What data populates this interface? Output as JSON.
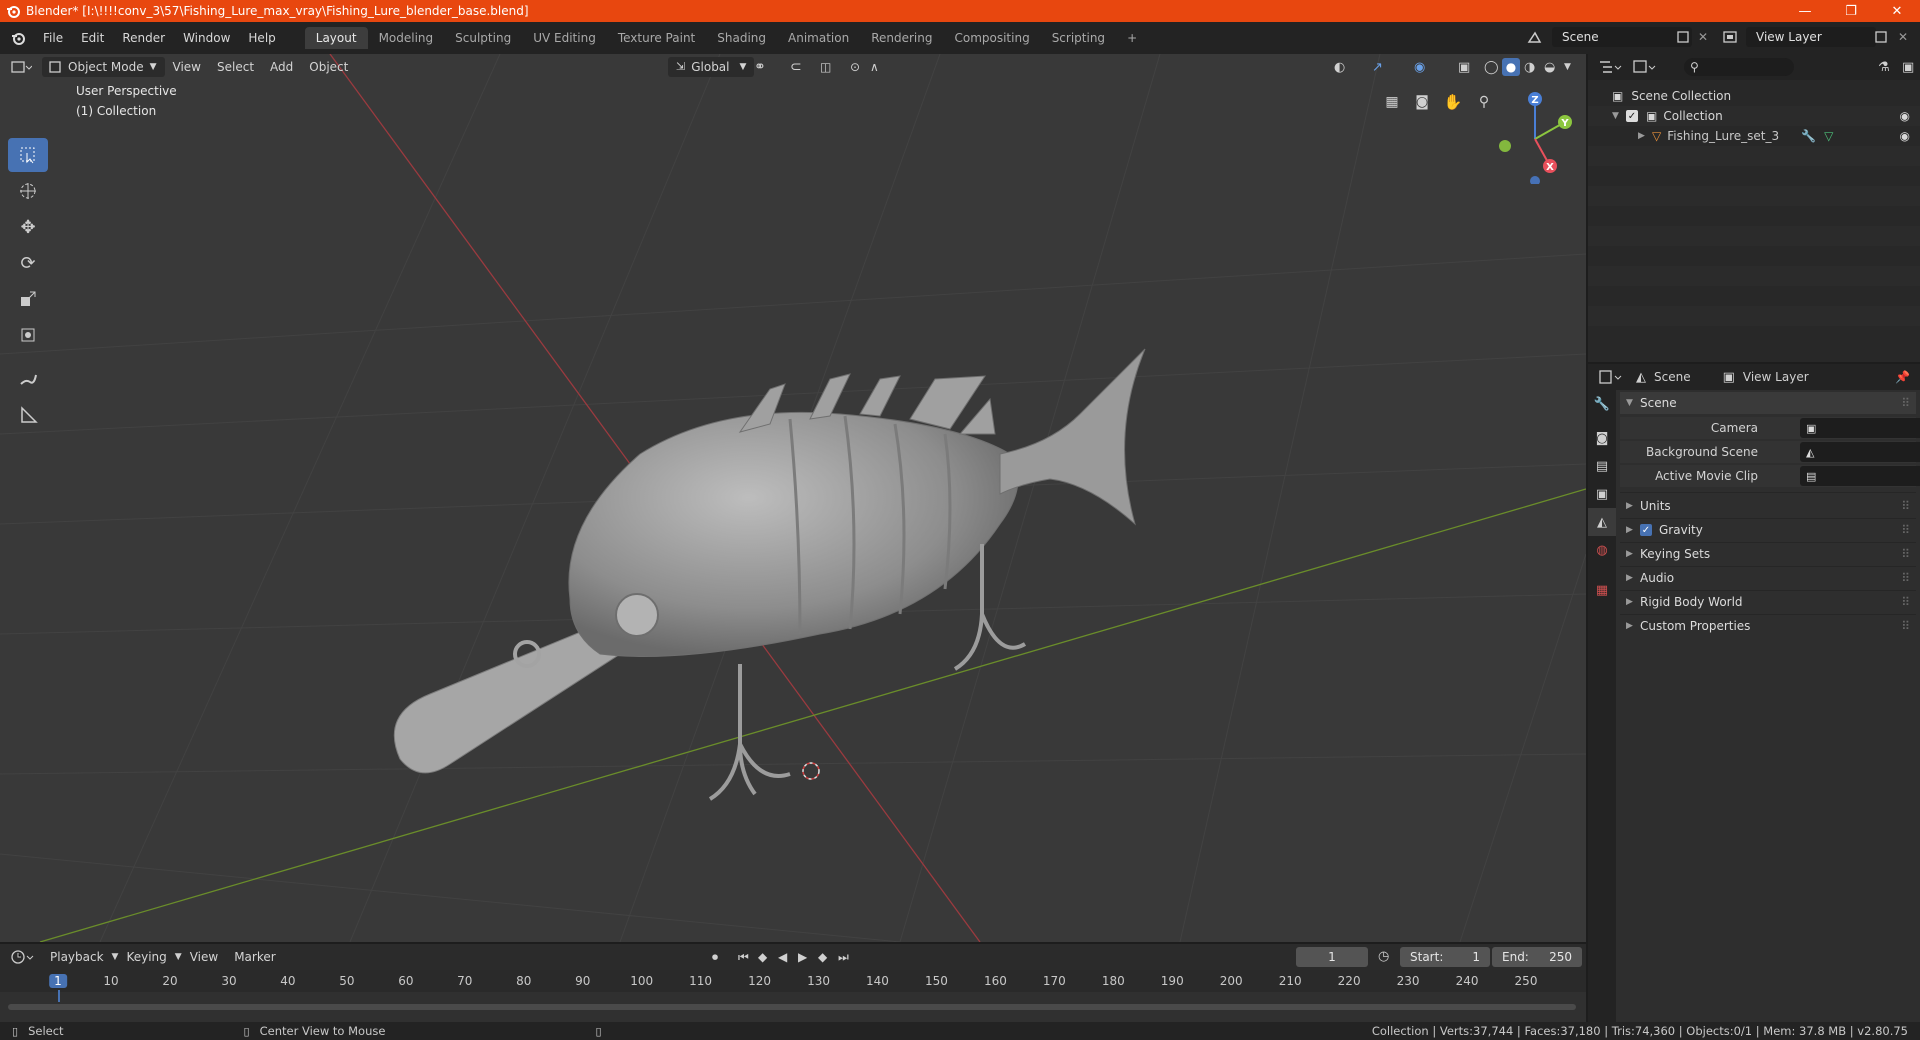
{
  "title_bar": {
    "title": "Blender* [I:\\!!!!conv_3\\57\\Fishing_Lure_max_vray\\Fishing_Lure_blender_base.blend]",
    "minimize": "—",
    "maximize": "❐",
    "close": "✕"
  },
  "menu": {
    "items": [
      "File",
      "Edit",
      "Render",
      "Window",
      "Help"
    ],
    "workspaces": [
      "Layout",
      "Modeling",
      "Sculpting",
      "UV Editing",
      "Texture Paint",
      "Shading",
      "Animation",
      "Rendering",
      "Compositing",
      "Scripting"
    ],
    "active_workspace": "Layout",
    "add_workspace": "+",
    "scene_name": "Scene",
    "view_layer": "View Layer"
  },
  "viewport": {
    "mode": "Object Mode",
    "menus": [
      "View",
      "Select",
      "Add",
      "Object"
    ],
    "transform_orientation": "Global",
    "perspective_label": "User Perspective",
    "collection_label": "(1) Collection",
    "gizmo_axes": {
      "z": "Z",
      "y": "Y",
      "x": "X"
    }
  },
  "outliner": {
    "scene_collection": "Scene Collection",
    "collection": "Collection",
    "object": "Fishing_Lure_set_3",
    "search_placeholder": ""
  },
  "properties": {
    "header_scene": "Scene",
    "header_view_layer": "View Layer",
    "panel_title": "Scene",
    "fields": {
      "camera": "Camera",
      "background_scene": "Background Scene",
      "active_movie_clip": "Active Movie Clip"
    },
    "subpanels": [
      "Units",
      "Gravity",
      "Keying Sets",
      "Audio",
      "Rigid Body World",
      "Custom Properties"
    ],
    "gravity_checked": true
  },
  "timeline": {
    "menus": [
      "Playback",
      "Keying",
      "View",
      "Marker"
    ],
    "current_frame": "1",
    "start_label": "Start:",
    "start": "1",
    "end_label": "End:",
    "end": "250",
    "ruler_marks": [
      "1",
      "10",
      "20",
      "30",
      "40",
      "50",
      "60",
      "70",
      "80",
      "90",
      "100",
      "110",
      "120",
      "130",
      "140",
      "150",
      "160",
      "170",
      "180",
      "190",
      "200",
      "210",
      "220",
      "230",
      "240",
      "250"
    ]
  },
  "status_bar": {
    "select": "Select",
    "center_view": "Center View to Mouse",
    "stats": "Collection | Verts:37,744 | Faces:37,180 | Tris:74,360 | Objects:0/1 | Mem: 37.8 MB | v2.80.75"
  },
  "colors": {
    "accent": "#4772b3",
    "titlebar": "#e8470f",
    "x_axis": "#e8505c",
    "y_axis": "#8cc63f",
    "z_axis": "#4a7fd6"
  }
}
